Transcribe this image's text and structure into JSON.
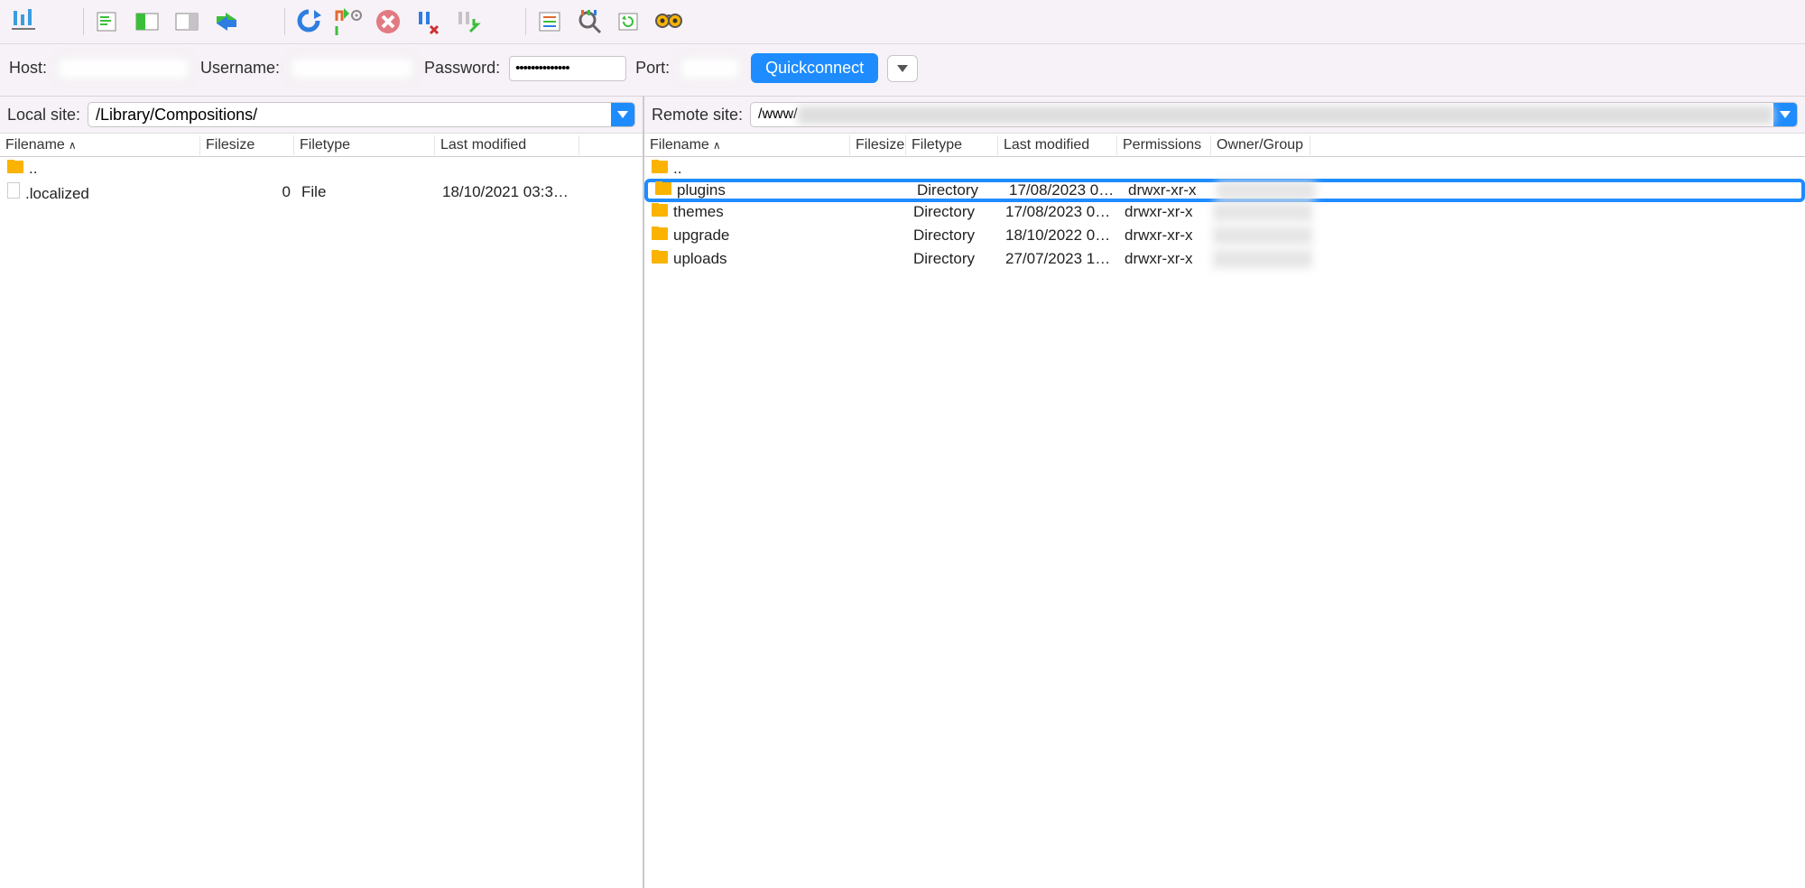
{
  "quickbar": {
    "host_label": "Host:",
    "username_label": "Username:",
    "password_label": "Password:",
    "port_label": "Port:",
    "quickconnect": "Quickconnect",
    "password_mask": "●●●●●●●●●●●●●●"
  },
  "local": {
    "site_label": "Local site:",
    "path": "/Library/Compositions/",
    "headers": {
      "filename": "Filename",
      "filesize": "Filesize",
      "filetype": "Filetype",
      "modified": "Last modified"
    },
    "rows": [
      {
        "name": "..",
        "size": "",
        "type": "",
        "modified": "",
        "icon": "folder"
      },
      {
        "name": ".localized",
        "size": "0",
        "type": "File",
        "modified": "18/10/2021 03:3…",
        "icon": "file"
      }
    ]
  },
  "remote": {
    "site_label": "Remote site:",
    "path_prefix": "/www/",
    "headers": {
      "filename": "Filename",
      "filesize": "Filesize",
      "filetype": "Filetype",
      "modified": "Last modified",
      "permissions": "Permissions",
      "owner": "Owner/Group"
    },
    "rows": [
      {
        "name": "..",
        "type": "",
        "modified": "",
        "permissions": "",
        "highlight": false
      },
      {
        "name": "plugins",
        "type": "Directory",
        "modified": "17/08/2023 0…",
        "permissions": "drwxr-xr-x",
        "highlight": true
      },
      {
        "name": "themes",
        "type": "Directory",
        "modified": "17/08/2023 0…",
        "permissions": "drwxr-xr-x",
        "highlight": false
      },
      {
        "name": "upgrade",
        "type": "Directory",
        "modified": "18/10/2022 0…",
        "permissions": "drwxr-xr-x",
        "highlight": false
      },
      {
        "name": "uploads",
        "type": "Directory",
        "modified": "27/07/2023 1…",
        "permissions": "drwxr-xr-x",
        "highlight": false
      }
    ]
  }
}
